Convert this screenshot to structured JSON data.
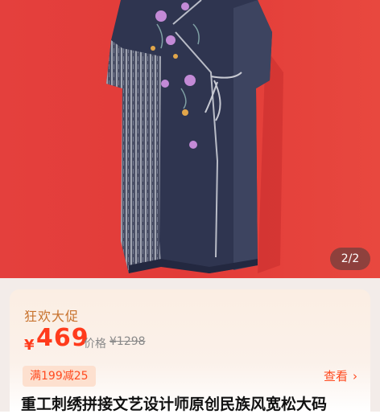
{
  "gallery": {
    "counter": "2/2",
    "background_color": "#e33a3a",
    "garment_color": "#2f3550"
  },
  "promo": {
    "label": "狂欢大促"
  },
  "price": {
    "currency": "¥",
    "current": "469",
    "original_label": "价格",
    "original": "¥1298",
    "accent_color": "#ff3b1c"
  },
  "coupon": {
    "label": "满199减25",
    "view_label": "查看"
  },
  "product": {
    "title": "重工刺绣拼接文艺设计师原创民族风宽松大码"
  }
}
